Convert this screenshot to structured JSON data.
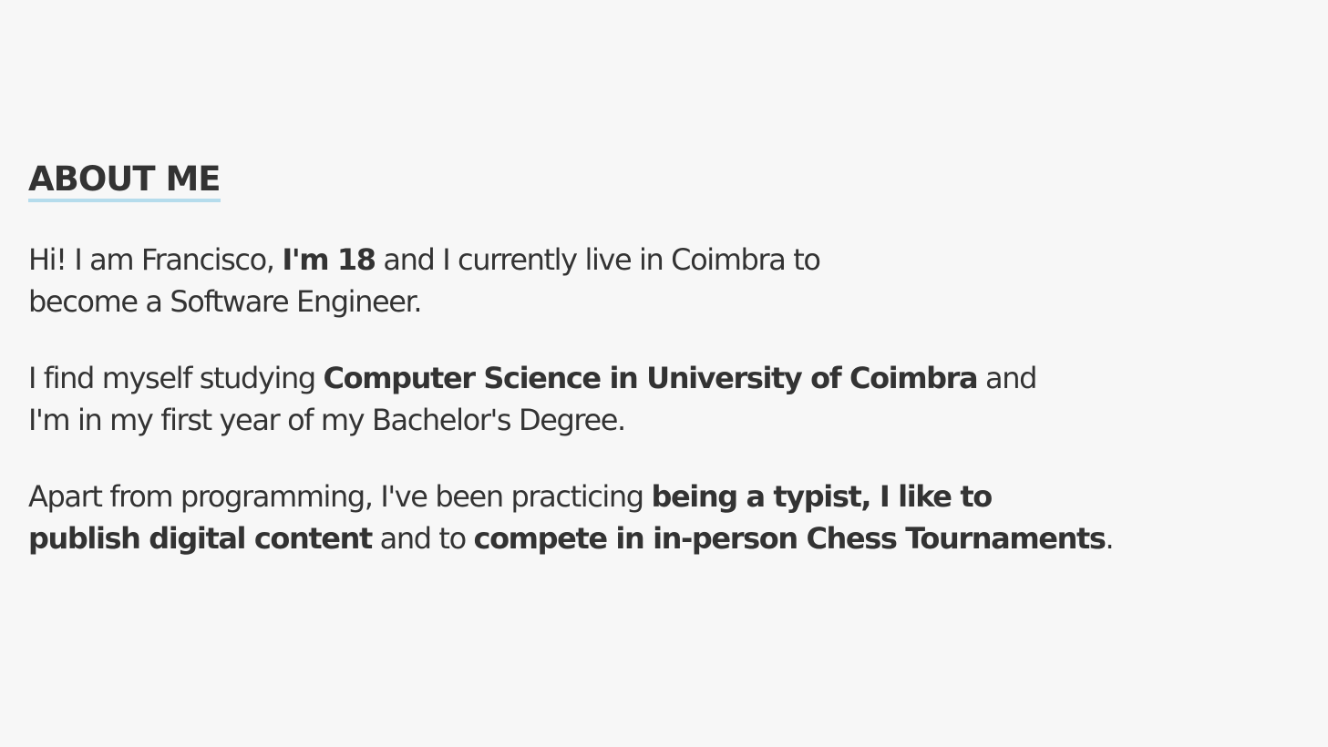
{
  "about": {
    "title": "ABOUT ME",
    "paragraphs": [
      {
        "line1": {
          "a": "Hi! I am Francisco, ",
          "b": "I'm 18",
          "c": " and I currently live in Coimbra to"
        },
        "line2": {
          "a": "become a Software Engineer."
        }
      },
      {
        "line1": {
          "a": "I find myself studying ",
          "b": "Computer Science in University of Coimbra",
          "c": " and"
        },
        "line2": {
          "a": "I'm in my first year of my Bachelor's Degree."
        }
      },
      {
        "line1": {
          "a": "Apart from programming, I've been practicing ",
          "b": "being a typist, I like to"
        },
        "line2": {
          "a": "publish digital content",
          "b": " and to ",
          "c": "compete in in-person Chess Tournaments",
          "d": "."
        }
      }
    ]
  },
  "colors": {
    "background": "#f7f7f7",
    "text": "#333333",
    "title_underline": "#b5dcec"
  }
}
